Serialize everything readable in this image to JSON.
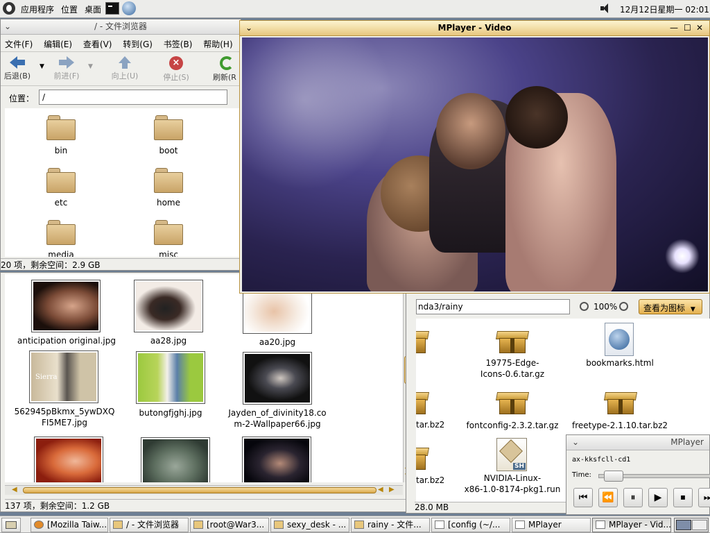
{
  "top_panel": {
    "menus": [
      "应用程序",
      "位置",
      "桌面"
    ],
    "clock": "12月12日星期一 02:01"
  },
  "file_browser_1": {
    "title": "/ - 文件浏览器",
    "menubar": [
      "文件(F)",
      "编辑(E)",
      "查看(V)",
      "转到(G)",
      "书签(B)",
      "帮助(H)"
    ],
    "toolbar": {
      "back": "后退(B)",
      "forward": "前进(F)",
      "up": "向上(U)",
      "stop": "停止(S)",
      "refresh": "刷新(R"
    },
    "location_label": "位置：",
    "location_value": "/",
    "folders": [
      "bin",
      "boot",
      "etc",
      "home",
      "media",
      "misc"
    ],
    "status": "20 项，剩余空间：2.9 GB"
  },
  "image_browser": {
    "images": [
      "anticipation original.jpg",
      "aa28.jpg",
      "aa20.jpg",
      "562945pBkmx_5ywDXQ\nFI5ME7.jpg",
      "butongfjghj.jpg",
      "Jayden_of_divinity18.co\nm-2-Wallpaper66.jpg"
    ],
    "thumb_caption": "Sierra",
    "status": "137 项，剩余空间：1.2 GB"
  },
  "mplayer_video": {
    "title": "MPlayer - Video"
  },
  "rainy_browser": {
    "location_value": "nda3/rainy",
    "zoom": "100%",
    "view_button": "查看为图标",
    "files": [
      "19775-Edge-\nIcons-0.6.tar.gz",
      "bookmarks.html",
      "tar.bz2",
      "fontconfig-2.3.2.tar.gz",
      "freetype-2.1.10.tar.bz2",
      "tar.bz2",
      "NVIDIA-Linux-\nx86-1.0-8174-pkg1.run"
    ],
    "sh_badge": "SH",
    "status": "28.0 MB"
  },
  "mplayer_control": {
    "title": "MPlayer",
    "filename": "ax-kksfcll-cd1",
    "time_label": "Time:",
    "seek_progress": 0.05
  },
  "taskbar": {
    "items": [
      "[Mozilla Taiw...",
      "/ - 文件浏览器",
      "[root@War3...",
      "sexy_desk - ...",
      "rainy - 文件...",
      "[config (~/...",
      "MPlayer",
      "MPlayer - Vid..."
    ]
  },
  "colors": {
    "active_title": "#e7c77e",
    "panel_bg": "#ececea",
    "video_bg": "#2a2350"
  }
}
